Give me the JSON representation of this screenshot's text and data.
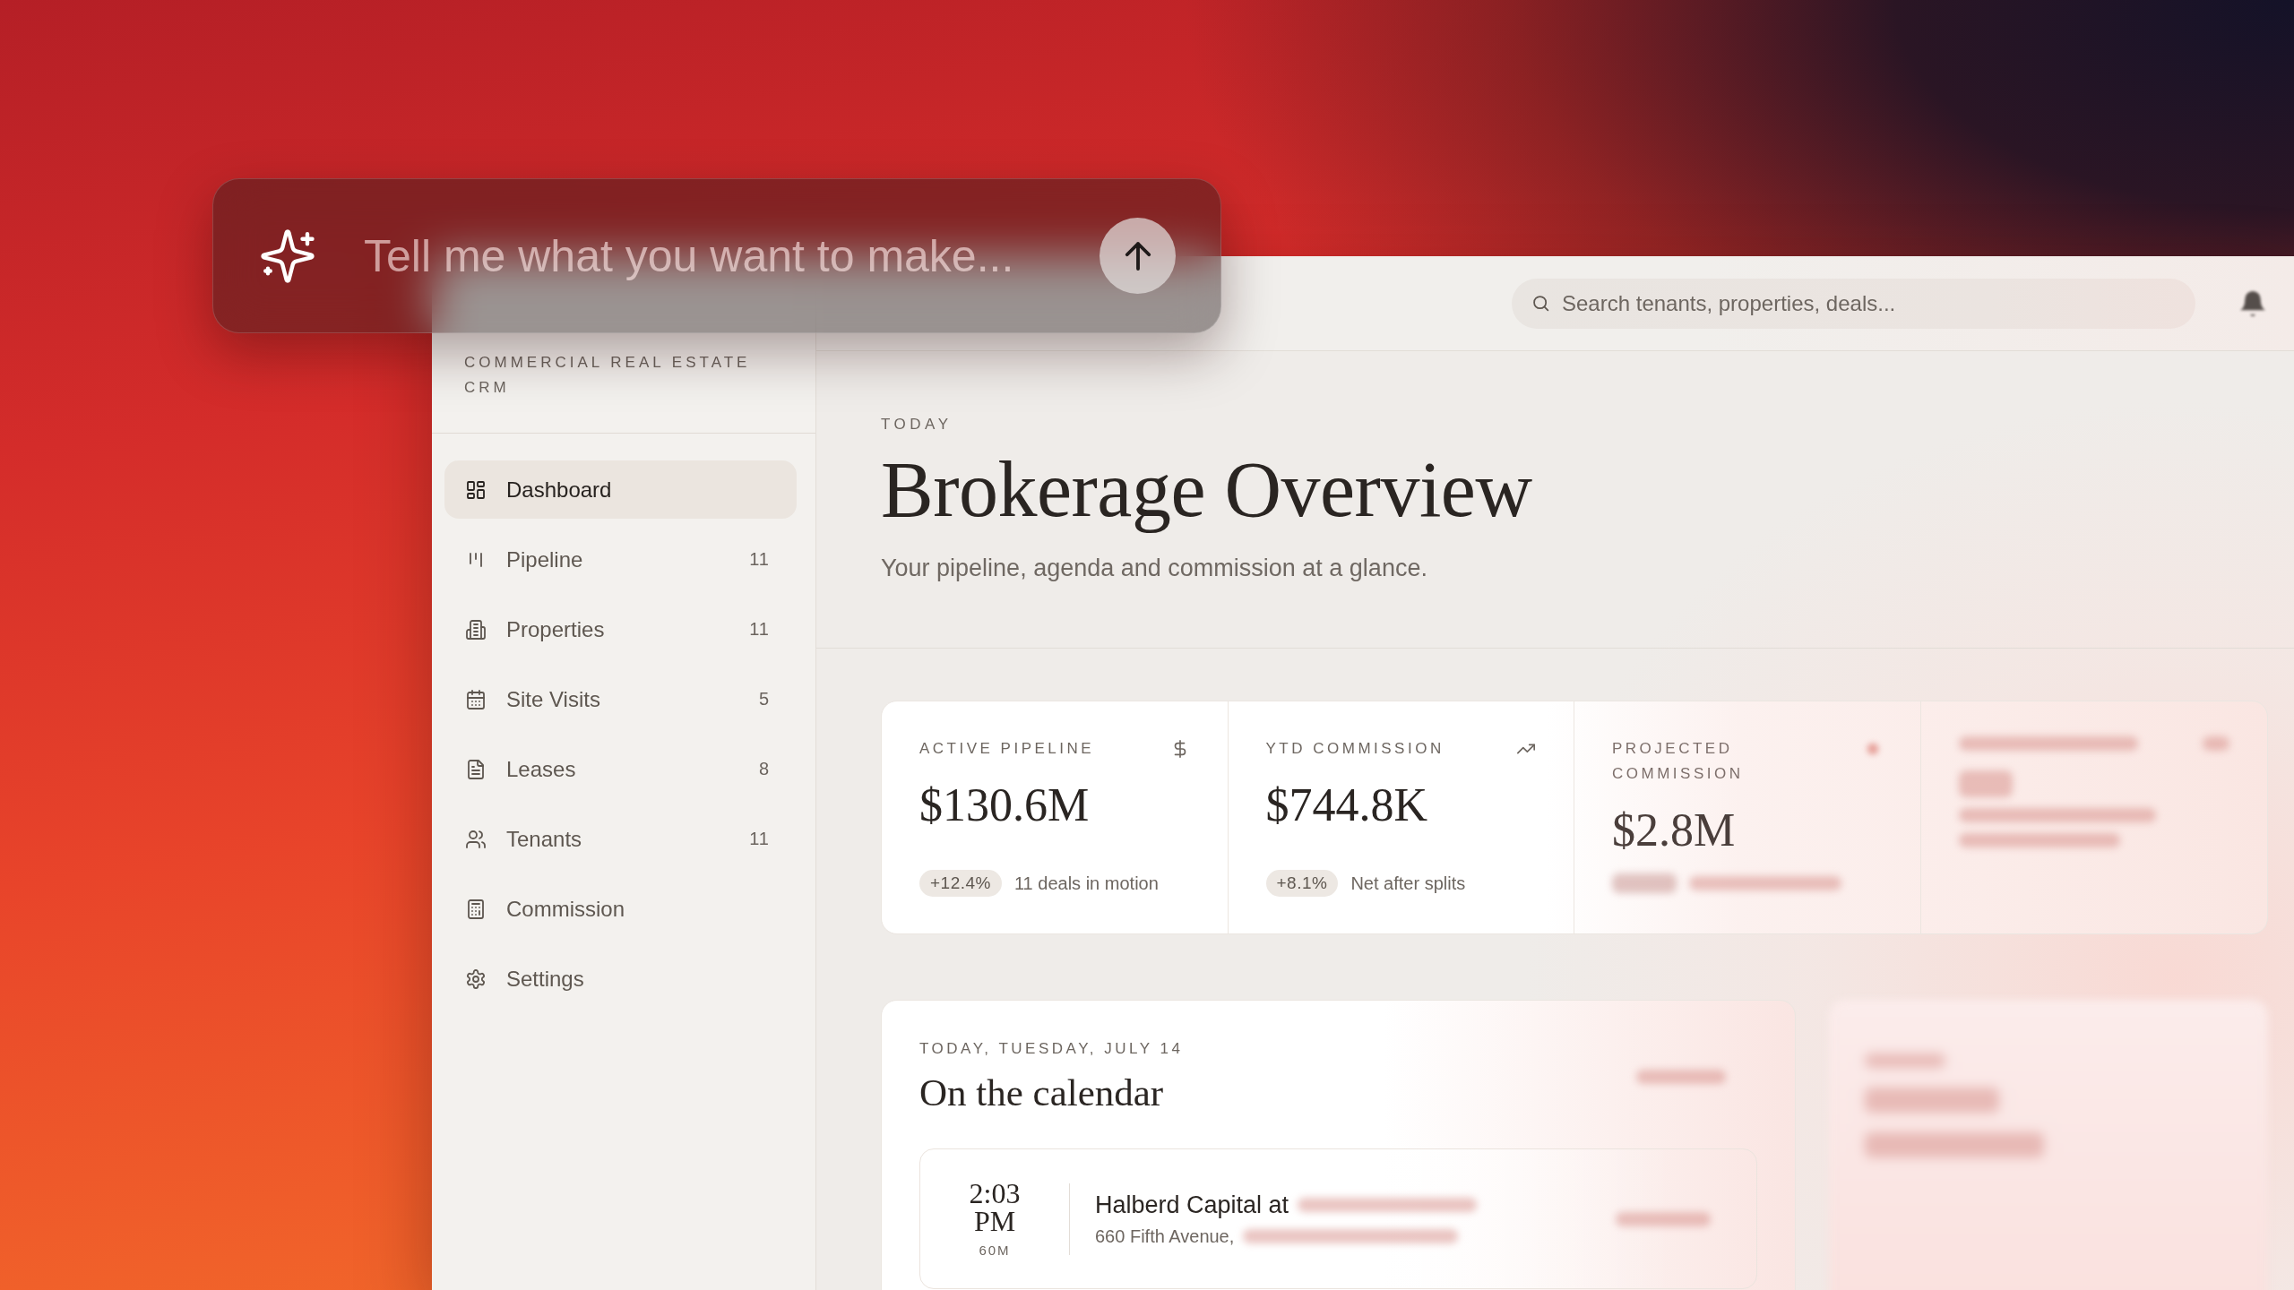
{
  "prompt": {
    "placeholder": "Tell me what you want to make..."
  },
  "sidebar": {
    "tagline": "COMMERCIAL REAL ESTATE CRM",
    "items": [
      {
        "label": "Dashboard",
        "selected": true
      },
      {
        "label": "Pipeline",
        "count": "11",
        "selected": false
      },
      {
        "label": "Properties",
        "count": "11",
        "selected": false
      },
      {
        "label": "Site Visits",
        "count": "5",
        "selected": false
      },
      {
        "label": "Leases",
        "count": "8",
        "selected": false
      },
      {
        "label": "Tenants",
        "count": "11",
        "selected": false
      },
      {
        "label": "Commission",
        "selected": false
      },
      {
        "label": "Settings",
        "selected": false
      }
    ]
  },
  "topbar": {
    "search": {
      "placeholder": "Search tenants, properties, deals..."
    }
  },
  "header": {
    "eyebrow": "TODAY",
    "title": "Brokerage Overview",
    "subtitle": "Your pipeline, agenda and commission at a glance."
  },
  "stats": [
    {
      "label": "ACTIVE PIPELINE",
      "value": "$130.6M",
      "change": "+12.4%",
      "note": "11 deals in motion"
    },
    {
      "label": "YTD COMMISSION",
      "value": "$744.8K",
      "change": "+8.1%",
      "note": "Net after splits"
    },
    {
      "label": "PROJECTED COMMISSION",
      "value": "$2.8M"
    }
  ],
  "calendar": {
    "eyebrow": "TODAY, TUESDAY, JULY 14",
    "title": "On the calendar",
    "events": [
      {
        "time": "2:03",
        "period": "PM",
        "duration": "60M",
        "title": "Halberd Capital at",
        "address": "660 Fifth Avenue,"
      }
    ]
  }
}
